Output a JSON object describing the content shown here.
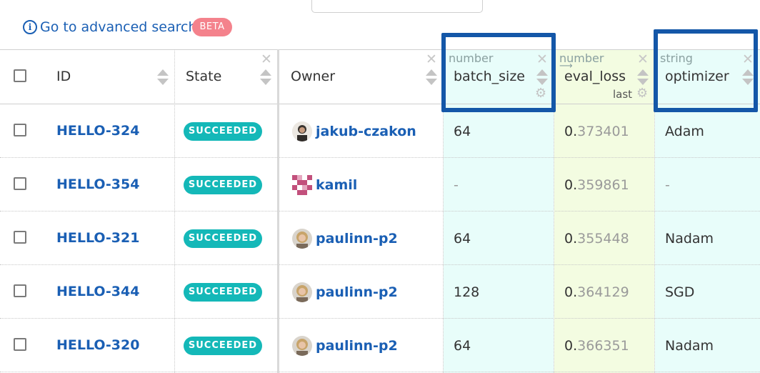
{
  "toolbar": {
    "advanced_search_label": "Go to advanced search",
    "beta_badge": "BETA"
  },
  "colors": {
    "link": "#1a5fb4",
    "succeeded": "#14b8b8",
    "beta": "#f4828c",
    "numeric_col_bg": "#e8fdfa",
    "eval_col_bg": "#f3fce1",
    "highlight_border": "#1457a8"
  },
  "columns": {
    "id": {
      "label": "ID"
    },
    "state": {
      "label": "State"
    },
    "owner": {
      "label": "Owner"
    },
    "batch_size": {
      "type": "number",
      "label": "batch_size"
    },
    "eval_loss": {
      "type": "number",
      "label": "eval_loss",
      "aggregation": "last"
    },
    "optimizer": {
      "type": "string",
      "label": "optimizer"
    }
  },
  "rows": [
    {
      "id": "HELLO-324",
      "state": "SUCCEEDED",
      "owner": "jakub-czakon",
      "avatar": "avatar-photo",
      "batch_size": "64",
      "eval_loss_int": "0.",
      "eval_loss_frac": "373401",
      "optimizer": "Adam"
    },
    {
      "id": "HELLO-354",
      "state": "SUCCEEDED",
      "owner": "kamil",
      "avatar": "avatar-identicon",
      "batch_size": "-",
      "eval_loss_int": "0.",
      "eval_loss_frac": "359861",
      "optimizer": "-"
    },
    {
      "id": "HELLO-321",
      "state": "SUCCEEDED",
      "owner": "paulinn-p2",
      "avatar": "avatar-photo",
      "batch_size": "64",
      "eval_loss_int": "0.",
      "eval_loss_frac": "355448",
      "optimizer": "Nadam"
    },
    {
      "id": "HELLO-344",
      "state": "SUCCEEDED",
      "owner": "paulinn-p2",
      "avatar": "avatar-photo",
      "batch_size": "128",
      "eval_loss_int": "0.",
      "eval_loss_frac": "364129",
      "optimizer": "SGD"
    },
    {
      "id": "HELLO-320",
      "state": "SUCCEEDED",
      "owner": "paulinn-p2",
      "avatar": "avatar-photo",
      "batch_size": "64",
      "eval_loss_int": "0.",
      "eval_loss_frac": "366351",
      "optimizer": "Nadam"
    }
  ]
}
